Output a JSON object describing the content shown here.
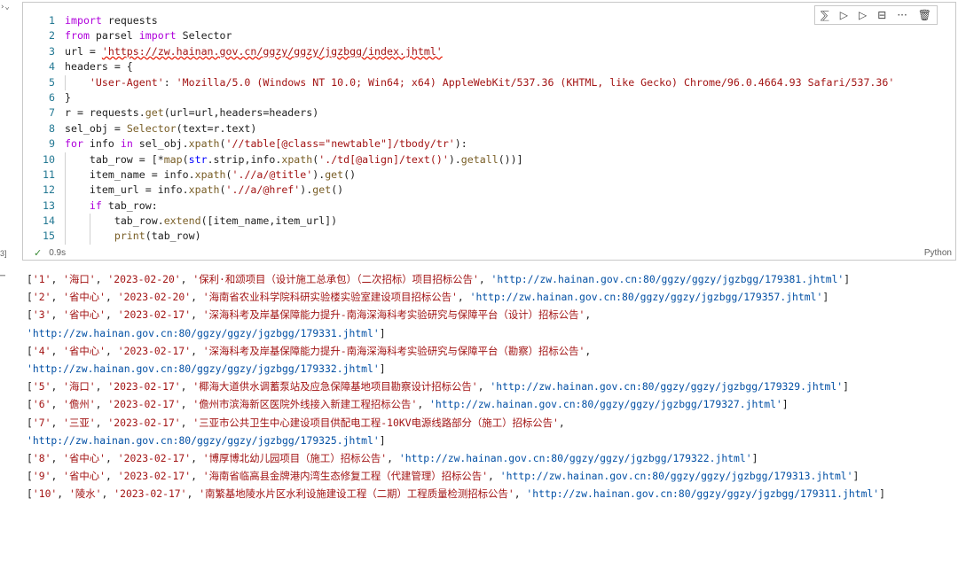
{
  "cell": {
    "toolbar": [
      "run-by-line-icon",
      "execute-above-icon",
      "execute-below-icon",
      "split-cell-icon",
      "more-icon",
      "delete-icon"
    ],
    "execution_count": "3]",
    "exec_time": "0.9s",
    "language": "Python",
    "lines": [
      {
        "n": "1",
        "t": "import requests"
      },
      {
        "n": "2",
        "t": "from parsel import Selector"
      },
      {
        "n": "3",
        "t": "url = 'https://zw.hainan.gov.cn/ggzy/ggzy/jgzbgg/index.jhtml'"
      },
      {
        "n": "4",
        "t": "headers = {"
      },
      {
        "n": "5",
        "t": "    'User-Agent': 'Mozilla/5.0 (Windows NT 10.0; Win64; x64) AppleWebKit/537.36 (KHTML, like Gecko) Chrome/96.0.4664.93 Safari/537.36'"
      },
      {
        "n": "6",
        "t": "}"
      },
      {
        "n": "7",
        "t": "r = requests.get(url=url,headers=headers)"
      },
      {
        "n": "8",
        "t": "sel_obj = Selector(text=r.text)"
      },
      {
        "n": "9",
        "t": "for info in sel_obj.xpath('//table[@class=\"newtable\"]/tbody/tr'):"
      },
      {
        "n": "10",
        "t": "    tab_row = [*map(str.strip,info.xpath('./td[@align]/text()').getall())]"
      },
      {
        "n": "11",
        "t": "    item_name = info.xpath('.//a/@title').get()"
      },
      {
        "n": "12",
        "t": "    item_url = info.xpath('.//a/@href').get()"
      },
      {
        "n": "13",
        "t": "    if tab_row:"
      },
      {
        "n": "14",
        "t": "        tab_row.extend([item_name,item_url])"
      },
      {
        "n": "15",
        "t": "        print(tab_row)"
      }
    ]
  },
  "output": {
    "lines": [
      "['1', '海口', '2023-02-20', '保利·和颂项目（设计施工总承包）（二次招标）项目招标公告', 'http://zw.hainan.gov.cn:80/ggzy/ggzy/jgzbgg/179381.jhtml']",
      "['2', '省中心', '2023-02-20', '海南省农业科学院科研实验楼实验室建设项目招标公告', 'http://zw.hainan.gov.cn:80/ggzy/ggzy/jgzbgg/179357.jhtml']",
      "['3', '省中心', '2023-02-17', '深海科考及岸基保障能力提升-南海深海科考实验研究与保障平台（设计）招标公告',",
      "'http://zw.hainan.gov.cn:80/ggzy/ggzy/jgzbgg/179331.jhtml']",
      "['4', '省中心', '2023-02-17', '深海科考及岸基保障能力提升-南海深海科考实验研究与保障平台（勘察）招标公告',",
      "'http://zw.hainan.gov.cn:80/ggzy/ggzy/jgzbgg/179332.jhtml']",
      "['5', '海口', '2023-02-17', '椰海大道供水调蓄泵站及应急保障基地项目勘察设计招标公告', 'http://zw.hainan.gov.cn:80/ggzy/ggzy/jgzbgg/179329.jhtml']",
      "['6', '儋州', '2023-02-17', '儋州市滨海新区医院外线接入新建工程招标公告', 'http://zw.hainan.gov.cn:80/ggzy/ggzy/jgzbgg/179327.jhtml']",
      "['7', '三亚', '2023-02-17', '三亚市公共卫生中心建设项目供配电工程-10KV电源线路部分（施工）招标公告',",
      "'http://zw.hainan.gov.cn:80/ggzy/ggzy/jgzbgg/179325.jhtml']",
      "['8', '省中心', '2023-02-17', '博厚博北幼儿园项目（施工）招标公告', 'http://zw.hainan.gov.cn:80/ggzy/ggzy/jgzbgg/179322.jhtml']",
      "['9', '省中心', '2023-02-17', '海南省临高县金牌港内湾生态修复工程（代建管理）招标公告', 'http://zw.hainan.gov.cn:80/ggzy/ggzy/jgzbgg/179313.jhtml']",
      "['10', '陵水', '2023-02-17', '南繁基地陵水片区水利设施建设工程（二期）工程质量检测招标公告', 'http://zw.hainan.gov.cn:80/ggzy/ggzy/jgzbgg/179311.jhtml']"
    ]
  }
}
